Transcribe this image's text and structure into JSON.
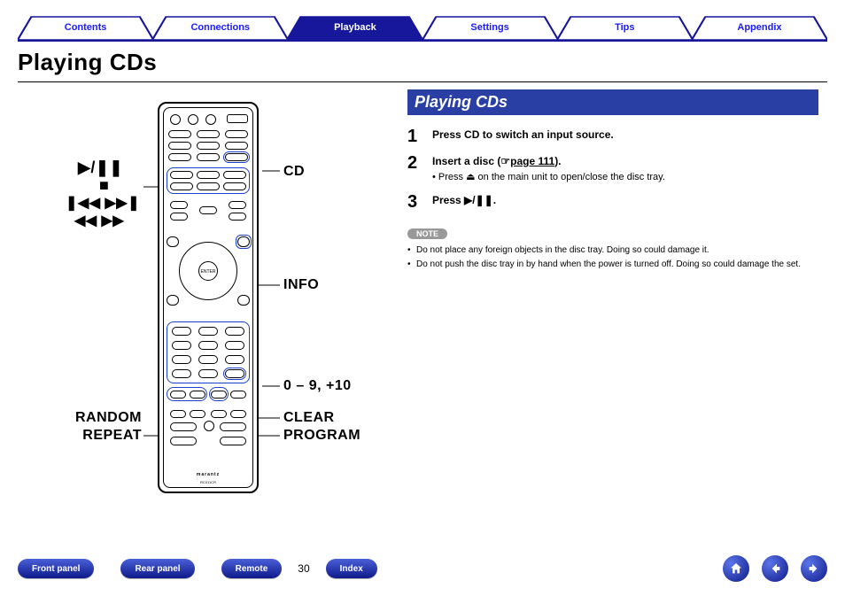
{
  "tabs": [
    "Contents",
    "Connections",
    "Playback",
    "Settings",
    "Tips",
    "Appendix"
  ],
  "active_tab_index": 2,
  "title": "Playing CDs",
  "callouts": {
    "play_pause": "▶/❚❚",
    "stop": "■",
    "skip": "❚◀◀ ▶▶❚",
    "seek": "◀◀ ▶▶",
    "cd": "CD",
    "info": "INFO",
    "numbers": "0 – 9, +10",
    "clear": "CLEAR",
    "program": "PROGRAM",
    "random": "RANDOM",
    "repeat": "REPEAT"
  },
  "remote": {
    "brand": "marantz",
    "model": "RC011CR"
  },
  "right": {
    "section_title": "Playing CDs",
    "steps": [
      {
        "n": "1",
        "main": "Press CD to switch an input source."
      },
      {
        "n": "2",
        "main_prefix": "Insert a disc (",
        "link_icon": "☞",
        "link_text": "page 111",
        "main_suffix": ").",
        "sub": "• Press ⏏ on the main unit to open/close the disc tray."
      },
      {
        "n": "3",
        "main": "Press ▶/❚❚."
      }
    ],
    "note_label": "NOTE",
    "notes": [
      "Do not place any foreign objects in the disc tray. Doing so could damage it.",
      "Do not push the disc tray in by hand when the power is turned off. Doing so could damage the set."
    ]
  },
  "footer": {
    "buttons": [
      "Front panel",
      "Rear panel",
      "Remote"
    ],
    "page_number": "30",
    "index": "Index"
  }
}
